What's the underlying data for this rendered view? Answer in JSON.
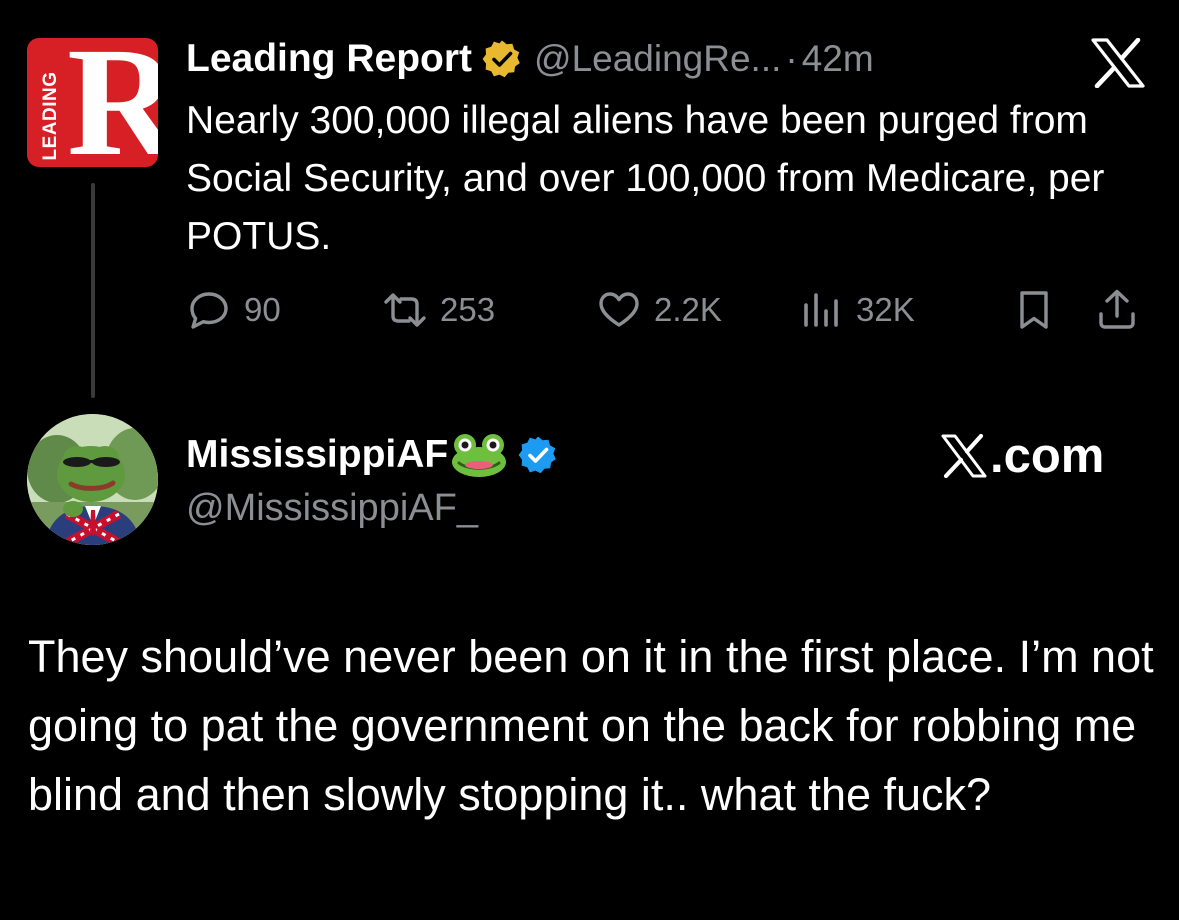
{
  "parent_tweet": {
    "avatar": {
      "letter": "R",
      "vertical_text": "LEADING",
      "color": "#d62026"
    },
    "author_name": "Leading Report",
    "verified_badge": "gold-verified-icon",
    "handle": "@LeadingRe...",
    "separator": "·",
    "time": "42m",
    "platform_icon": "x-logo-icon",
    "text": "Nearly 300,000 illegal aliens have been purged from Social Security, and over 100,000 from Medicare, per POTUS.",
    "actions": {
      "replies": "90",
      "reposts": "253",
      "likes": "2.2K",
      "views": "32K"
    }
  },
  "reply_tweet": {
    "avatar_icon": "pepe-frog-avatar",
    "author_name": "MississippiAF",
    "name_emoji": "frog-emoji",
    "verified_badge": "blue-verified-icon",
    "handle": "@MississippiAF_",
    "site_label": ".com",
    "text": "They should’ve never been on it in the first place. I’m not going to pat the government on the back for robbing me blind and then slowly stopping it.. what the fuck?"
  },
  "colors": {
    "background": "#000000",
    "text": "#ffffff",
    "muted": "#8b8f94",
    "gold_badge": "#e8b830",
    "blue_badge": "#1d9bf0",
    "brand_red": "#d62026"
  }
}
